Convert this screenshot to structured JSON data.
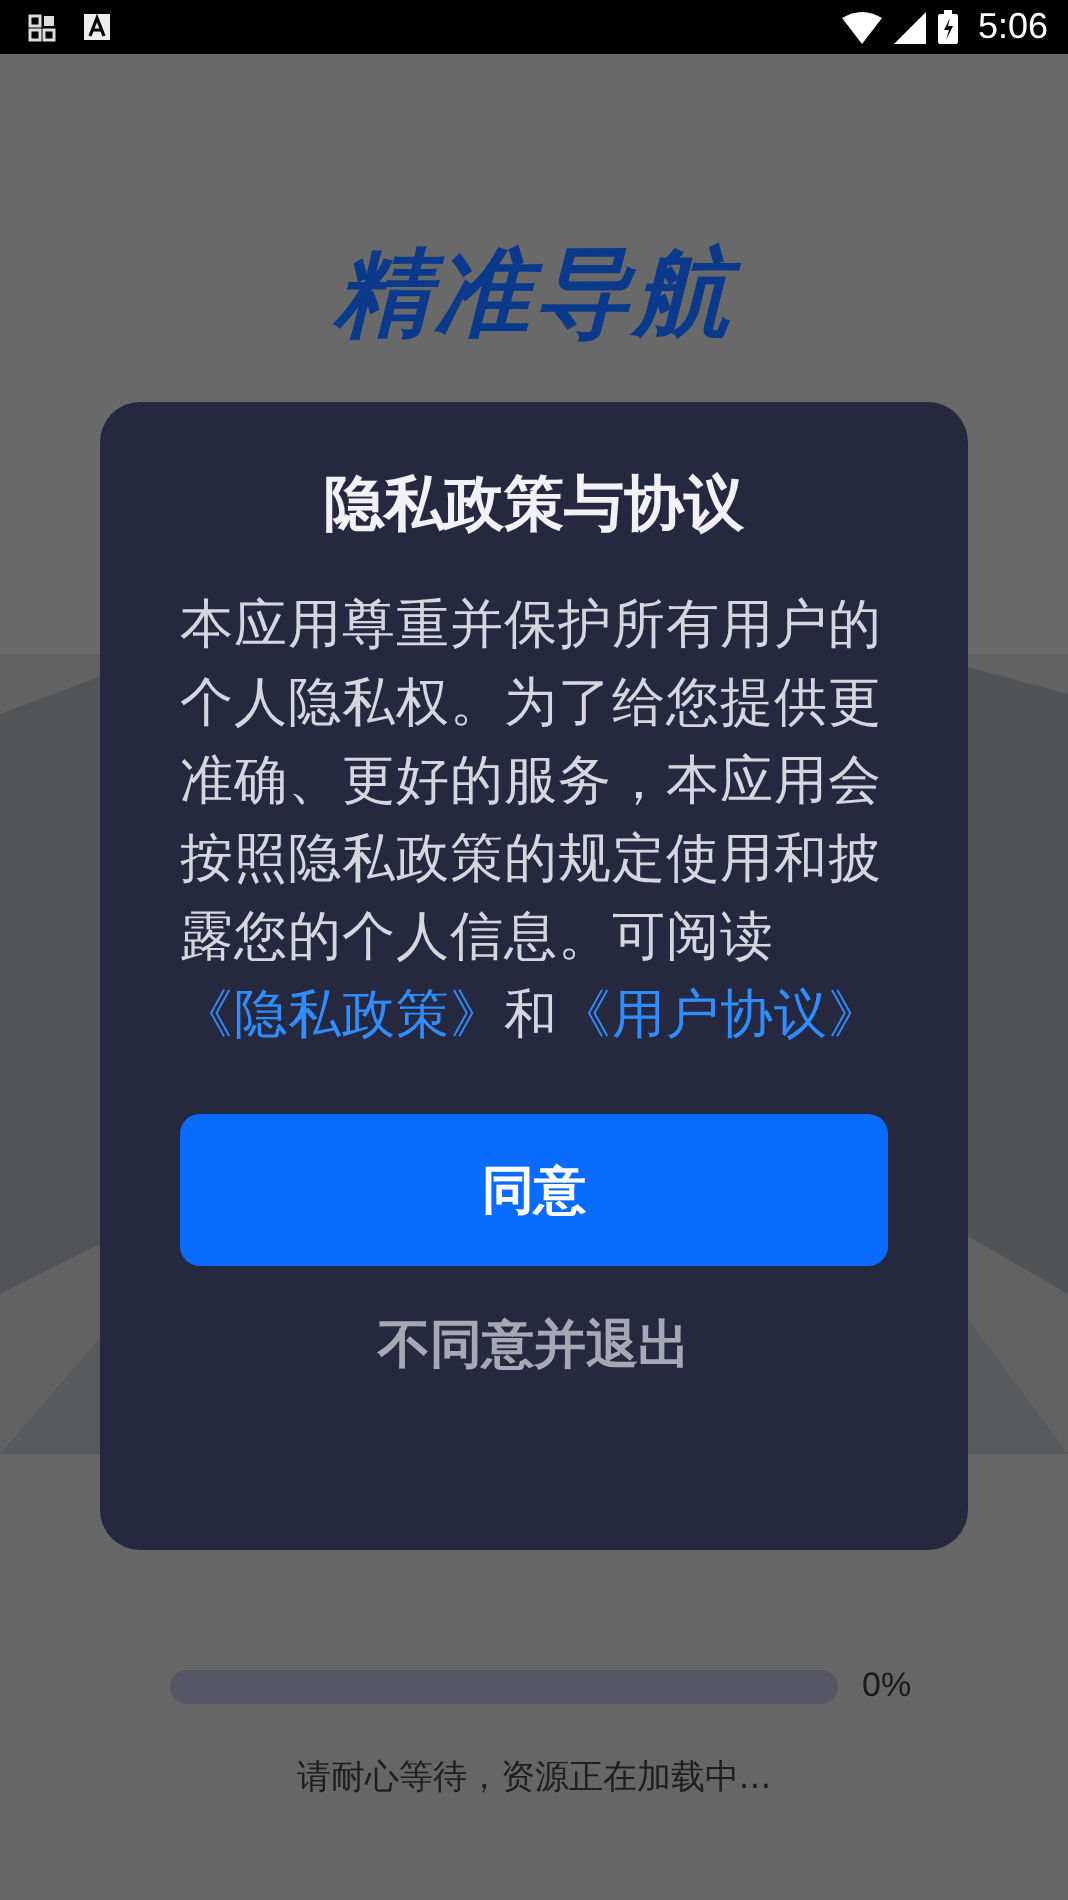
{
  "status_bar": {
    "time": "5:06"
  },
  "splash": {
    "logo": "精准导航",
    "progress": {
      "level": 0,
      "reading": "0%"
    },
    "loading_text": "请耐心等待，资源正在加载中..."
  },
  "dialog": {
    "title": "隐私政策与协议",
    "body": [
      {
        "kind": "text",
        "text": "本应用尊重并保护所有用户的个人隐私权。为了给您提供更准确、更好的服务，本应用会按照隐私政策的规定使用和披露您的个人信息。可阅读"
      },
      {
        "kind": "link",
        "text": "《隐私政策》"
      },
      {
        "kind": "text",
        "text": "和"
      },
      {
        "kind": "link",
        "text": "《用户协议》"
      }
    ],
    "accept_button": "同意",
    "decline_button": "不同意并退出"
  }
}
